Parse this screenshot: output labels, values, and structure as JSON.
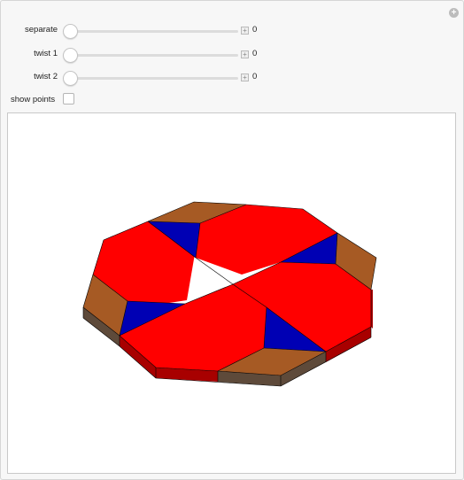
{
  "controls": {
    "sliders": [
      {
        "label": "separate",
        "value": "0"
      },
      {
        "label": "twist 1",
        "value": "0"
      },
      {
        "label": "twist 2",
        "value": "0"
      }
    ],
    "checkbox": {
      "label": "show points",
      "checked": false
    },
    "plus_symbol": "+",
    "corner_symbol": "+"
  },
  "colors": {
    "red": "#ff0000",
    "dark_red": "#a80000",
    "blue": "#0000b4",
    "brown": "#a65a24",
    "dark_brown": "#5e4a3a",
    "background": "#f7f7f7"
  }
}
